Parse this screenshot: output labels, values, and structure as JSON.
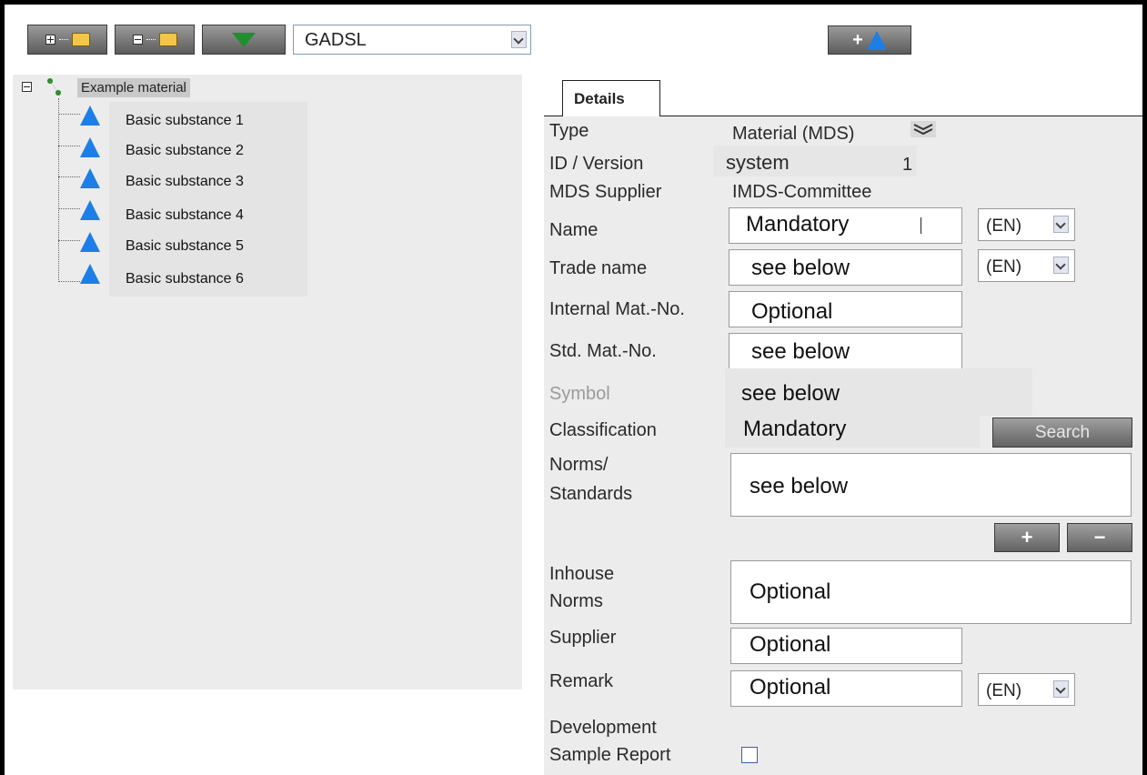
{
  "toolbar": {
    "buttons": [
      {
        "name": "expand-all-button",
        "icon": "expand-folder-icon"
      },
      {
        "name": "collapse-all-button",
        "icon": "collapse-folder-icon"
      },
      {
        "name": "filter-button",
        "icon": "filter-icon"
      }
    ],
    "list_select": {
      "value": "GADSL"
    },
    "add_substance_plus": "+"
  },
  "tree": {
    "root": "Example material",
    "items": [
      "Basic substance 1",
      "Basic substance 2",
      "Basic substance 3",
      "Basic substance 4",
      "Basic substance 5",
      "Basic substance 6"
    ]
  },
  "details": {
    "tab": "Details",
    "type_label": "Type",
    "type_value": "Material (MDS)",
    "id_label": "ID / Version",
    "id_value": "system",
    "version_value": "1",
    "supplier_mds_label": "MDS Supplier",
    "supplier_mds_value": "IMDS-Committee",
    "name_label": "Name",
    "name_value": "Mandatory",
    "name_lang": "(EN)",
    "trade_label": "Trade name",
    "trade_value": "see below",
    "trade_lang": "(EN)",
    "internal_label": "Internal Mat.-No.",
    "internal_value": "Optional",
    "std_label": "Std. Mat.-No.",
    "std_value": "see below",
    "symbol_label": "Symbol",
    "symbol_value": "see below",
    "class_label": "Classification",
    "class_value": "Mandatory",
    "search_label": "Search",
    "norms_label_1": "Norms/",
    "norms_label_2": "Standards",
    "norms_value": "see below",
    "plus_label": "+",
    "minus_label": "−",
    "inhouse_label_1": "Inhouse",
    "inhouse_label_2": "Norms",
    "inhouse_value": "Optional",
    "supplier_label": "Supplier",
    "supplier_value": "Optional",
    "remark_label": "Remark",
    "remark_value": "Optional",
    "remark_lang": "(EN)",
    "dev_label_1": "Development",
    "dev_label_2": "Sample Report"
  },
  "colors": {
    "accent_triangle": "#1e7ee8",
    "button_gray": "#7a7a7a",
    "panel_gray": "#ececec"
  }
}
